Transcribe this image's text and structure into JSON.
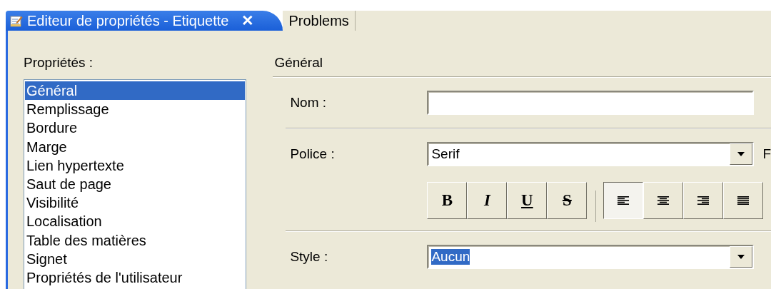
{
  "tabs": [
    {
      "label": "Editeur de propriétés - Etiquette",
      "selected": true,
      "close": "✕"
    },
    {
      "label": "Problems",
      "selected": false
    }
  ],
  "properties": {
    "title": "Propriétés :",
    "items": [
      {
        "label": "Général",
        "selected": true
      },
      {
        "label": "Remplissage",
        "selected": false
      },
      {
        "label": "Bordure",
        "selected": false
      },
      {
        "label": "Marge",
        "selected": false
      },
      {
        "label": "Lien hypertexte",
        "selected": false
      },
      {
        "label": "Saut de page",
        "selected": false
      },
      {
        "label": "Visibilité",
        "selected": false
      },
      {
        "label": "Localisation",
        "selected": false
      },
      {
        "label": "Table des matières",
        "selected": false
      },
      {
        "label": "Signet",
        "selected": false
      },
      {
        "label": "Propriétés de l'utilisateur",
        "selected": false
      }
    ]
  },
  "section": {
    "title": "Général",
    "name_field": {
      "label": "Nom :"
    },
    "font": {
      "label": "Police :",
      "value": "Serif",
      "trailing_label": "F"
    },
    "toolbar": [
      {
        "kind": "bold",
        "label": "B",
        "pressed": false
      },
      {
        "kind": "italic",
        "label": "I",
        "pressed": false
      },
      {
        "kind": "underline",
        "label": "U",
        "pressed": false
      },
      {
        "kind": "strike",
        "label": "S",
        "pressed": false
      },
      {
        "kind": "align-left",
        "pressed": true
      },
      {
        "kind": "align-center",
        "pressed": false
      },
      {
        "kind": "align-right",
        "pressed": false
      },
      {
        "kind": "justify",
        "pressed": false
      }
    ],
    "style": {
      "label": "Style :",
      "value": "Aucun",
      "value_selected": true
    }
  }
}
